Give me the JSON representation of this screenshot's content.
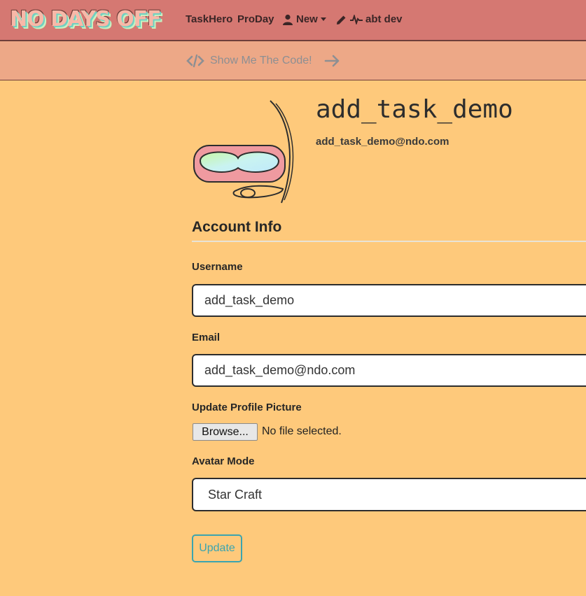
{
  "nav": {
    "brand": "NO DAYS OFF",
    "items": [
      {
        "label": "TaskHero"
      },
      {
        "label": "ProDay"
      },
      {
        "label": "New"
      },
      {
        "label": "abt dev"
      }
    ]
  },
  "codebar": {
    "label": "Show Me The Code!"
  },
  "profile": {
    "username": "add_task_demo",
    "email": "add_task_demo@ndo.com"
  },
  "account": {
    "title": "Account Info",
    "username_label": "Username",
    "username_value": "add_task_demo",
    "email_label": "Email",
    "email_value": "add_task_demo@ndo.com",
    "picture_label": "Update Profile Picture",
    "browse_label": "Browse...",
    "file_status": "No file selected.",
    "avatar_mode_label": "Avatar Mode",
    "avatar_mode_value": "Star Craft",
    "update_label": "Update"
  },
  "colors": {
    "navbar": "#d57872",
    "codebar": "#eda887",
    "page": "#fec97b",
    "accent": "#3aa4b0"
  }
}
